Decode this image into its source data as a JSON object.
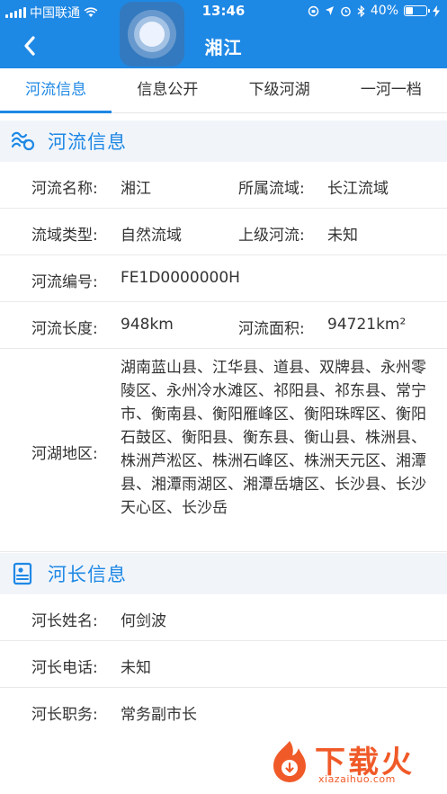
{
  "status_bar": {
    "carrier": "中国联通",
    "time": "13:46",
    "battery": "40%",
    "battery_level": 0.4
  },
  "nav": {
    "title": "湘江"
  },
  "tabs": [
    {
      "label": "河流信息",
      "active": true
    },
    {
      "label": "信息公开",
      "active": false
    },
    {
      "label": "下级河湖",
      "active": false
    },
    {
      "label": "一河一档",
      "active": false
    }
  ],
  "river_section": {
    "title": "河流信息",
    "icon": "waves-icon",
    "rows": {
      "name_label": "河流名称:",
      "name_value": "湘江",
      "basin_label": "所属流域:",
      "basin_value": "长江流域",
      "basin_type_label": "流域类型:",
      "basin_type_value": "自然流域",
      "parent_label": "上级河流:",
      "parent_value": "未知",
      "code_label": "河流编号:",
      "code_value": "FE1D0000000H",
      "length_label": "河流长度:",
      "length_value": "948km",
      "area_label": "河流面积:",
      "area_value": "94721km²",
      "region_label": "河湖地区:",
      "region_value": "湖南蓝山县、江华县、道县、双牌县、永州零陵区、永州冷水滩区、祁阳县、祁东县、常宁市、衡南县、衡阳雁峰区、衡阳珠晖区、衡阳石鼓区、衡阳县、衡东县、衡山县、株洲县、株洲芦淞区、株洲石峰区、株洲天元区、湘潭县、湘潭雨湖区、湘潭岳塘区、长沙县、长沙天心区、长沙岳"
    }
  },
  "chief_section": {
    "title": "河长信息",
    "icon": "profile-card-icon",
    "rows": {
      "name_label": "河长姓名:",
      "name_value": "何剑波",
      "phone_label": "河长电话:",
      "phone_value": "未知",
      "position_label": "河长职务:",
      "position_value": "常务副市长"
    }
  },
  "watermark": {
    "text": "下载火",
    "url": "xiazaihuo.com"
  },
  "colors": {
    "primary": "#1e88e5",
    "section_bg": "#f1f5fa",
    "watermark": "#f05a28"
  }
}
